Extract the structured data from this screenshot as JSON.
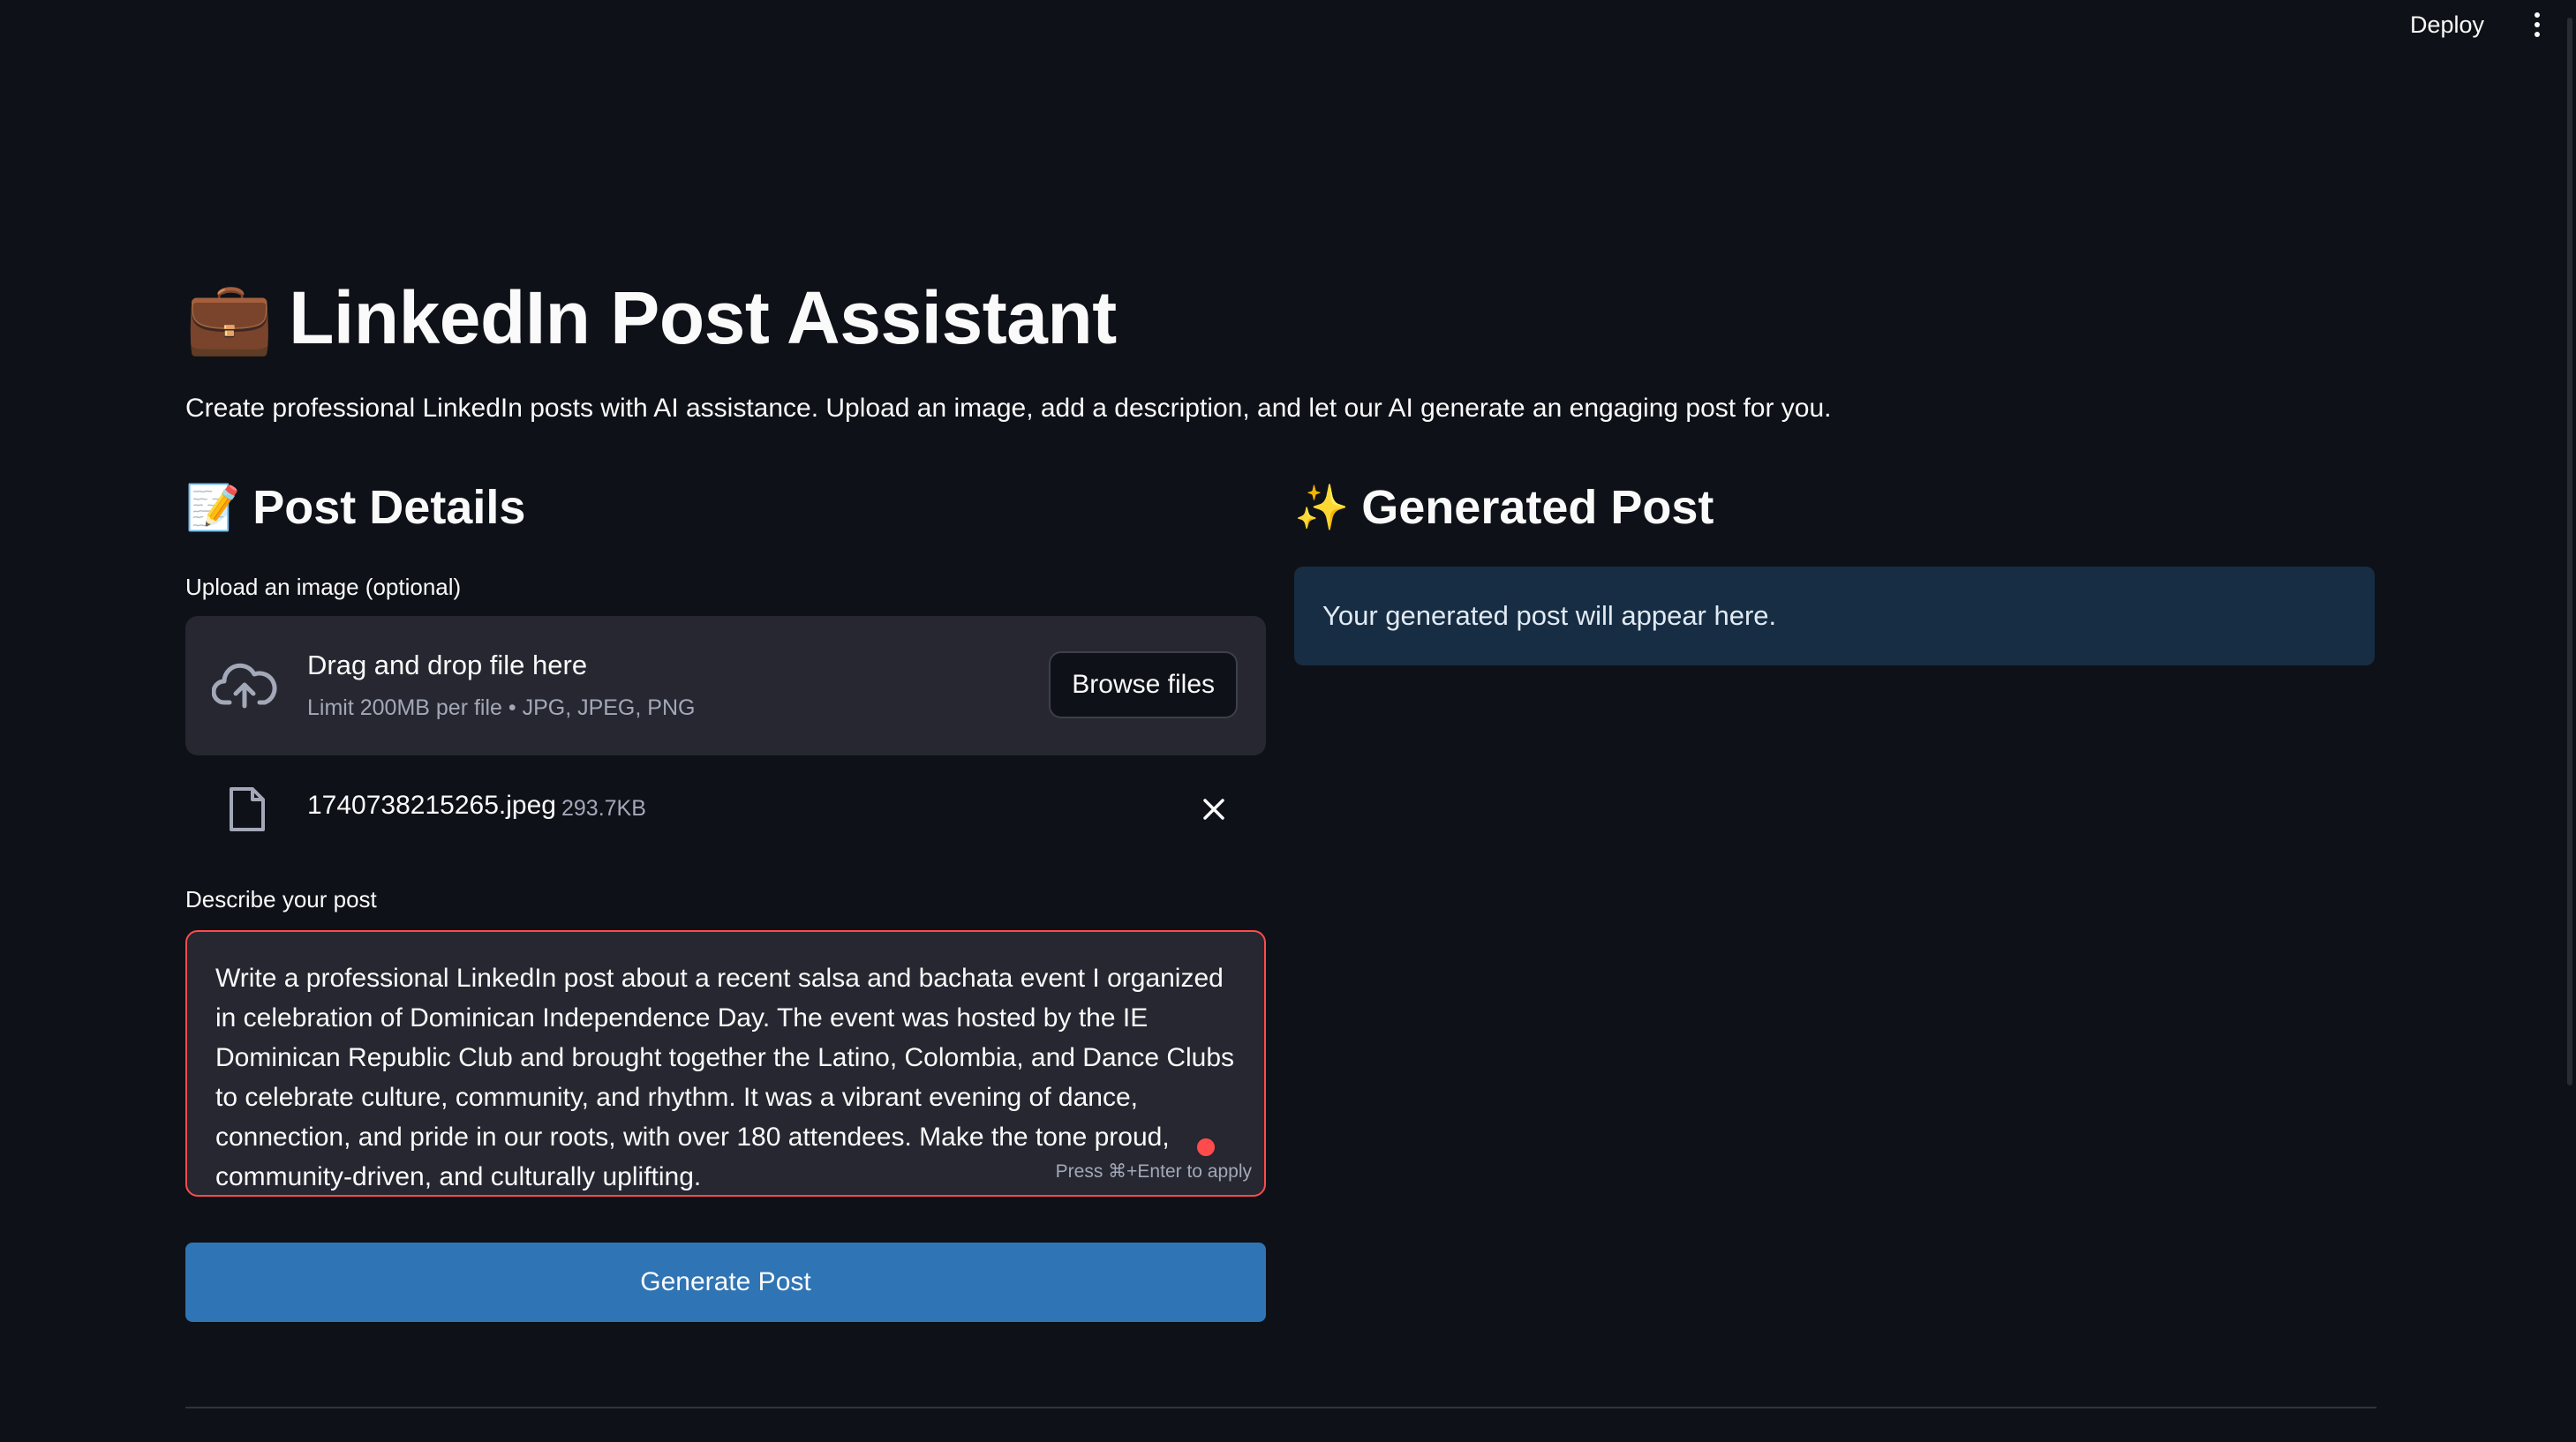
{
  "header": {
    "deploy_label": "Deploy",
    "menu_icon": "kebab-menu-icon"
  },
  "page": {
    "title_icon": "💼",
    "title": "LinkedIn Post Assistant",
    "subtitle": "Create professional LinkedIn posts with AI assistance. Upload an image, add a description, and let our AI generate an engaging post for you."
  },
  "post_details": {
    "heading_icon": "📝",
    "heading": "Post Details",
    "upload": {
      "label": "Upload an image (optional)",
      "drop_text": "Drag and drop file here",
      "limit_text": "Limit 200MB per file • JPG, JPEG, PNG",
      "browse_label": "Browse files",
      "icon": "cloud-upload-icon"
    },
    "file": {
      "name": "1740738215265.jpeg",
      "size": "293.7KB",
      "icon": "file-icon"
    },
    "description": {
      "label": "Describe your post",
      "value": "Write a professional LinkedIn post about a recent salsa and bachata event I organized in celebration of Dominican Independence Day. The event was hosted by the IE Dominican Republic Club and brought together the Latino, Colombia, and Dance Clubs to celebrate culture, community, and rhythm. It was a vibrant evening of dance, connection, and pride in our roots, with over 180 attendees. Make the tone proud, community-driven, and culturally uplifting.",
      "hint": "Press ⌘+Enter to apply"
    },
    "generate_label": "Generate Post"
  },
  "generated_post": {
    "heading_icon": "✨",
    "heading": "Generated Post",
    "placeholder": "Your generated post will appear here."
  },
  "colors": {
    "background": "#0e1117",
    "panel": "#262730",
    "accent_error": "#ff4b4b",
    "primary_button": "#2f74b5",
    "info_box": "#172d43"
  }
}
